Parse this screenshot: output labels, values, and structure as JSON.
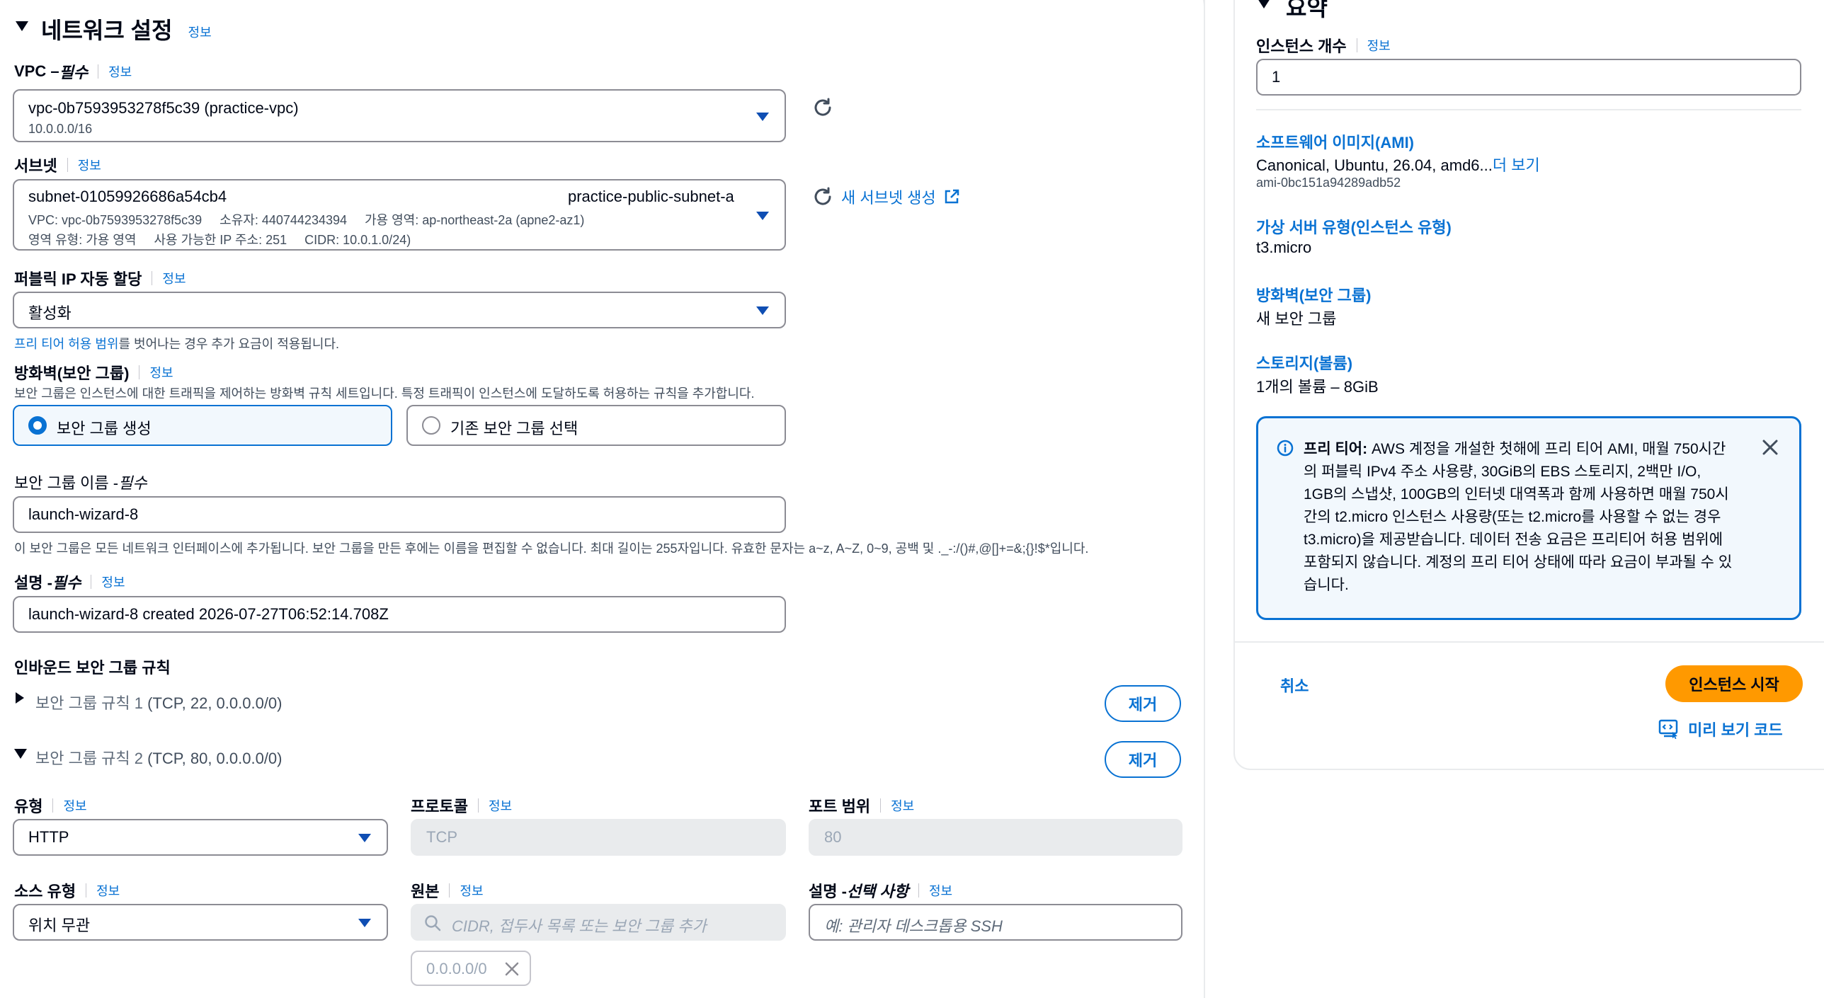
{
  "network": {
    "title": "네트워크 설정",
    "info": "정보",
    "vpc": {
      "label": "VPC – ",
      "label_req": "필수",
      "value": "vpc-0b7593953278f5c39 (practice-vpc)",
      "sub": "10.0.0.0/16"
    },
    "subnet": {
      "label": "서브넷",
      "value": "subnet-01059926686a54cb4",
      "name": "practice-public-subnet-a",
      "line2": "VPC: vpc-0b7593953278f5c39     소유자: 440744234394     가용 영역: ap-northeast-2a (apne2-az1)",
      "line3": "영역 유형: 가용 영역     사용 가능한 IP 주소: 251     CIDR: 10.0.1.0/24)",
      "new_subnet": "새 서브넷 생성"
    },
    "public_ip": {
      "label": "퍼블릭 IP 자동 할당",
      "value": "활성화",
      "help_link": "프리 티어 허용 범위",
      "help_rest": "를 벗어나는 경우 추가 요금이 적용됩니다."
    },
    "firewall": {
      "label": "방화벽(보안 그룹)",
      "desc": "보안 그룹은 인스턴스에 대한 트래픽을 제어하는 방화벽 규칙 세트입니다. 특정 트래픽이 인스턴스에 도달하도록 허용하는 규칙을 추가합니다.",
      "option_create": "보안 그룹 생성",
      "option_existing": "기존 보안 그룹 선택"
    },
    "sg_name": {
      "label": "보안 그룹 이름 - ",
      "label_req": "필수",
      "value": "launch-wizard-8",
      "help": "이 보안 그룹은 모든 네트워크 인터페이스에 추가됩니다. 보안 그룹을 만든 후에는 이름을 편집할 수 없습니다. 최대 길이는 255자입니다. 유효한 문자는 a~z, A~Z, 0~9, 공백 및 ._-:/()#,@[]+=&;{}!$*입니다."
    },
    "description": {
      "label": "설명 - ",
      "label_req": "필수",
      "value": "launch-wizard-8 created 2026-07-27T06:52:14.708Z"
    },
    "inbound": {
      "title": "인바운드 보안 그룹 규칙",
      "rule1_prefix": "보안 그룹 규칙 1",
      "rule1_suffix": " (TCP, 22, 0.0.0.0/0)",
      "rule2_prefix": "보안 그룹 규칙 2",
      "rule2_suffix": " (TCP, 80, 0.0.0.0/0)",
      "remove": "제거",
      "type_label": "유형",
      "type_value": "HTTP",
      "protocol_label": "프로토콜",
      "protocol_value": "TCP",
      "port_label": "포트 범위",
      "port_value": "80",
      "source_type_label": "소스 유형",
      "source_type_value": "위치 무관",
      "source_label": "원본",
      "source_placeholder": "CIDR, 접두사 목록 또는 보안 그룹 추가",
      "source_token": "0.0.0.0/0",
      "desc_label": "설명 - ",
      "desc_label_opt": "선택 사항",
      "desc_placeholder": "예: 관리자 데스크톱용 SSH"
    }
  },
  "summary": {
    "title": "요약",
    "instance_count_label": "인스턴스 개수",
    "instance_count_value": "1",
    "ami_label": "소프트웨어 이미지(AMI)",
    "ami_value": "Canonical, Ubuntu, 26.04, amd6...",
    "ami_more": "더 보기",
    "ami_id": "ami-0bc151a94289adb52",
    "instance_type_label": "가상 서버 유형(인스턴스 유형)",
    "instance_type_value": "t3.micro",
    "firewall_label": "방화벽(보안 그룹)",
    "firewall_value": "새 보안 그룹",
    "storage_label": "스토리지(볼륨)",
    "storage_value": "1개의 볼륨 – 8GiB",
    "free_tier_lines": [
      "의 퍼블릭 IPv4 주소 사용량, 30GiB의 EBS 스토리지, 2백만 I/O,",
      "1GB의 스냅샷, 100GB의 인터넷 대역폭과 함께 사용하면 매월 750시",
      "간의 t2.micro 인스턴스 사용량(또는 t2.micro를 사용할 수 없는 경우",
      "t3.micro)을 제공받습니다. 데이터 전송 요금은 프리티어 허용 범위에",
      "포함되지 않습니다. 계정의 프리 티어 상태에 따라 요금이 부과될 수 있",
      "습니다."
    ],
    "free_tier_bold": "프리 티어:",
    "free_tier_first": " AWS 계정을 개설한 첫해에 프리 티어 AMI, 매월 750시간",
    "cancel": "취소",
    "launch": "인스턴스 시작",
    "preview_code": "미리 보기 코드"
  },
  "colors": {
    "accent": "#0972d3",
    "launch_button": "#ff9900",
    "info_border": "#0972d3",
    "info_bg": "#f2f8fd"
  }
}
